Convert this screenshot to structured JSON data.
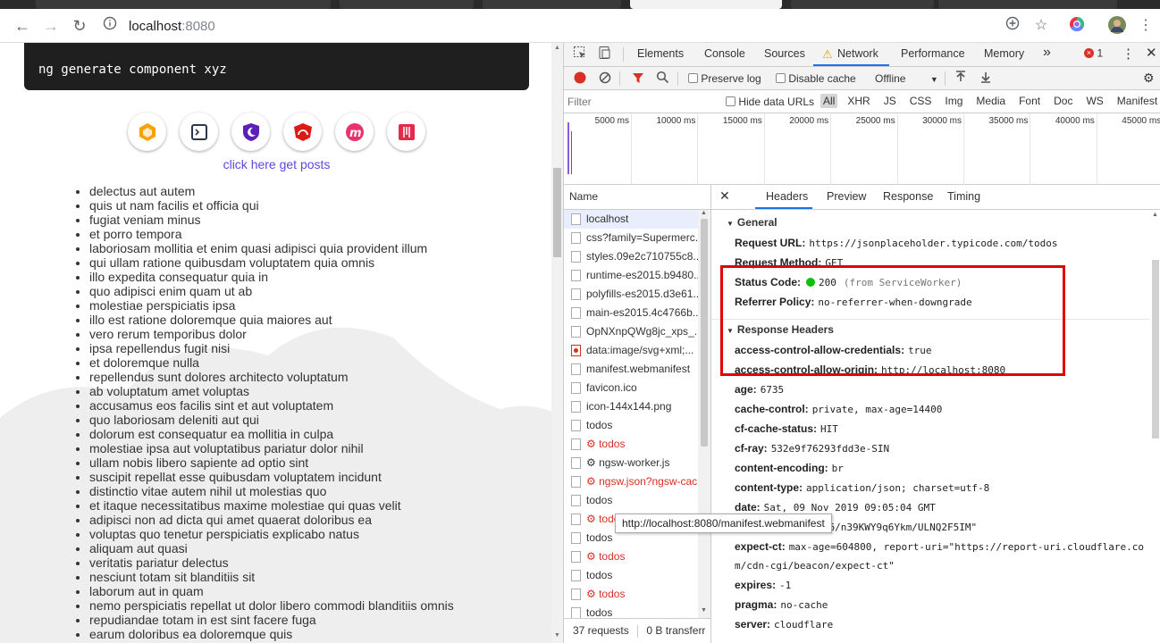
{
  "browser": {
    "url_host": "localhost",
    "url_port": ":8080",
    "icons": {
      "back": "arrow-left-icon",
      "forward": "arrow-right-icon",
      "reload": "reload-icon",
      "info": "info-icon",
      "add": "plus-circle-icon",
      "bookmark": "star-icon",
      "extension": "chrome-extension-icon",
      "profile": "avatar",
      "menu": "kebab-menu-icon"
    }
  },
  "page": {
    "command": "ng generate component xyz",
    "posts_link": "click here get posts",
    "items": [
      "delectus aut autem",
      "quis ut nam facilis et officia qui",
      "fugiat veniam minus",
      "et porro tempora",
      "laboriosam mollitia et enim quasi adipisci quia provident illum",
      "qui ullam ratione quibusdam voluptatem quia omnis",
      "illo expedita consequatur quia in",
      "quo adipisci enim quam ut ab",
      "molestiae perspiciatis ipsa",
      "illo est ratione doloremque quia maiores aut",
      "vero rerum temporibus dolor",
      "ipsa repellendus fugit nisi",
      "et doloremque nulla",
      "repellendus sunt dolores architecto voluptatum",
      "ab voluptatum amet voluptas",
      "accusamus eos facilis sint et aut voluptatem",
      "quo laboriosam deleniti aut qui",
      "dolorum est consequatur ea mollitia in culpa",
      "molestiae ipsa aut voluptatibus pariatur dolor nihil",
      "ullam nobis libero sapiente ad optio sint",
      "suscipit repellat esse quibusdam voluptatem incidunt",
      "distinctio vitae autem nihil ut molestias quo",
      "et itaque necessitatibus maxime molestiae qui quas velit",
      "adipisci non ad dicta qui amet quaerat doloribus ea",
      "voluptas quo tenetur perspiciatis explicabo natus",
      "aliquam aut quasi",
      "veritatis pariatur delectus",
      "nesciunt totam sit blanditiis sit",
      "laborum aut in quam",
      "nemo perspiciatis repellat ut dolor libero commodi blanditiis omnis",
      "repudiandae totam in est sint facere fuga",
      "earum doloribus ea doloremque quis"
    ]
  },
  "devtools": {
    "tabs": [
      "Elements",
      "Console",
      "Sources",
      "Network",
      "Performance",
      "Memory"
    ],
    "more": "»",
    "error_count": "1",
    "toolbar": {
      "preserve_log": "Preserve log",
      "disable_cache": "Disable cache",
      "throttle": "Offline"
    },
    "filter": {
      "placeholder": "Filter",
      "hide_data_urls": "Hide data URLs",
      "types": [
        "All",
        "XHR",
        "JS",
        "CSS",
        "Img",
        "Media",
        "Font",
        "Doc",
        "WS",
        "Manifest",
        "Other"
      ]
    },
    "timeline_ticks": [
      "5000 ms",
      "10000 ms",
      "15000 ms",
      "20000 ms",
      "25000 ms",
      "30000 ms",
      "35000 ms",
      "40000 ms",
      "45000 ms"
    ],
    "name_header": "Name",
    "requests": [
      {
        "name": "localhost",
        "error": false
      },
      {
        "name": "css?family=Supermerc...",
        "error": false
      },
      {
        "name": "styles.09e2c710755c8...",
        "error": false
      },
      {
        "name": "runtime-es2015.b9480...",
        "error": false
      },
      {
        "name": "polyfills-es2015.d3e61...",
        "error": false
      },
      {
        "name": "main-es2015.4c4766b...",
        "error": false
      },
      {
        "name": "OpNXnpQWg8jc_xps_...",
        "error": false
      },
      {
        "name": "data:image/svg+xml;...",
        "error": false
      },
      {
        "name": "manifest.webmanifest",
        "error": false
      },
      {
        "name": "favicon.ico",
        "error": false
      },
      {
        "name": "icon-144x144.png",
        "error": false
      },
      {
        "name": "todos",
        "error": false
      },
      {
        "name": "⚙ todos",
        "error": true
      },
      {
        "name": "⚙ ngsw-worker.js",
        "error": false
      },
      {
        "name": "⚙ ngsw.json?ngsw-cac...",
        "error": true
      },
      {
        "name": "todos",
        "error": false
      },
      {
        "name": "⚙ todos",
        "error": true
      },
      {
        "name": "todos",
        "error": false
      },
      {
        "name": "⚙ todos",
        "error": true
      },
      {
        "name": "todos",
        "error": false
      },
      {
        "name": "⚙ todos",
        "error": true
      },
      {
        "name": "todos",
        "error": false
      }
    ],
    "status_bar": "37 requests",
    "transferred": "0 B transferr",
    "tooltip": "http://localhost:8080/manifest.webmanifest",
    "detail_tabs": [
      "Headers",
      "Preview",
      "Response",
      "Timing"
    ],
    "general_title": "General",
    "general": [
      {
        "k": "Request URL:",
        "v": "https://jsonplaceholder.typicode.com/todos"
      },
      {
        "k": "Request Method:",
        "v": "GET"
      },
      {
        "k": "Status Code:",
        "v": "200",
        "note": "(from ServiceWorker)"
      },
      {
        "k": "Referrer Policy:",
        "v": "no-referrer-when-downgrade"
      }
    ],
    "response_title": "Response Headers",
    "response_headers": [
      {
        "k": "access-control-allow-credentials:",
        "v": "true"
      },
      {
        "k": "access-control-allow-origin:",
        "v": "http://localhost:8080"
      },
      {
        "k": "age:",
        "v": "6735"
      },
      {
        "k": "cache-control:",
        "v": "private, max-age=14400"
      },
      {
        "k": "cf-cache-status:",
        "v": "HIT"
      },
      {
        "k": "cf-ray:",
        "v": "532e9f76293fdd3e-SIN"
      },
      {
        "k": "content-encoding:",
        "v": "br"
      },
      {
        "k": "content-type:",
        "v": "application/json; charset=utf-8"
      },
      {
        "k": "date:",
        "v": "Sat, 09 Nov 2019 09:05:04 GMT"
      },
      {
        "k": "etag:",
        "v": "W/\"5ef7-4Ad6/n39KWY9q6Ykm/ULNQ2F5IM\""
      },
      {
        "k": "expect-ct:",
        "v": "max-age=604800, report-uri=\"https://report-uri.cloudflare.co",
        "cont": "m/cdn-cgi/beacon/expect-ct\""
      },
      {
        "k": "expires:",
        "v": "-1"
      },
      {
        "k": "pragma:",
        "v": "no-cache"
      },
      {
        "k": "server:",
        "v": "cloudflare"
      }
    ],
    "colors": {
      "accent": "#1a73e8",
      "highlight": "#e10000",
      "error": "#d93025",
      "link": "#5a49e0",
      "status_ok": "#0cc00c"
    }
  }
}
